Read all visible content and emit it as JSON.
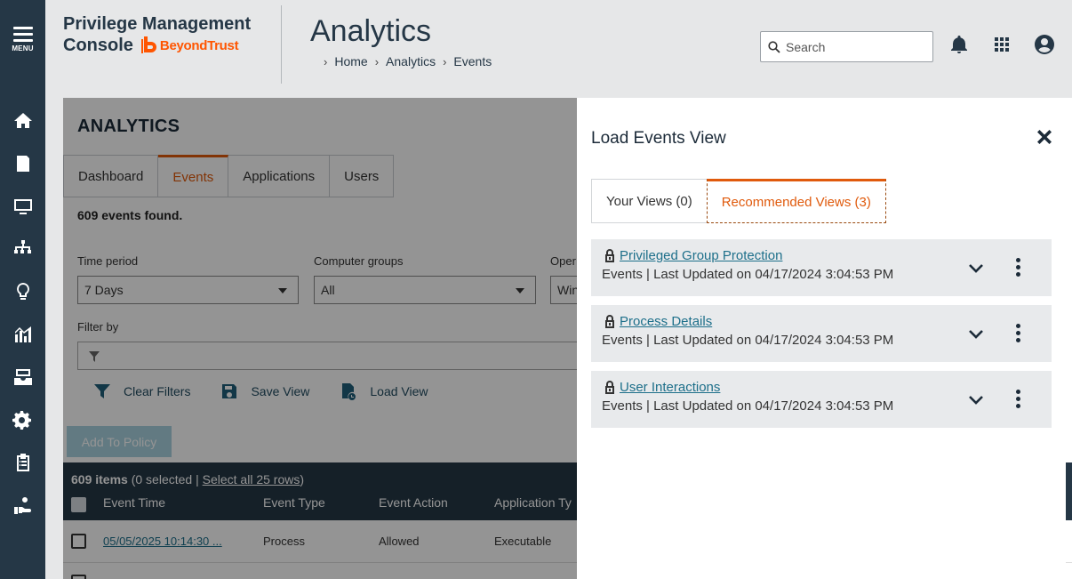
{
  "nav": {
    "menu_label": "MENU",
    "items": [
      "home-icon",
      "policy-icon",
      "computer-icon",
      "org-chart-icon",
      "lightbulb-icon",
      "analytics-icon",
      "inbox-icon",
      "settings-icon",
      "clipboard-icon",
      "hand-icon"
    ]
  },
  "header": {
    "brand_line1": "Privilege Management",
    "brand_line2": "Console",
    "brand_logo": "BeyondTrust",
    "page_title": "Analytics",
    "breadcrumb": [
      "Home",
      "Analytics",
      "Events"
    ],
    "search_placeholder": "Search"
  },
  "main": {
    "section_title": "ANALYTICS",
    "tabs": [
      "Dashboard",
      "Events",
      "Applications",
      "Users"
    ],
    "active_tab": "Events",
    "events_found": "609 events found.",
    "filters": {
      "time_period_label": "Time period",
      "time_period_value": "7 Days",
      "computer_groups_label": "Computer groups",
      "computer_groups_value": "All",
      "os_label_partial": "Oper",
      "os_value_partial": "Win",
      "filter_by_label": "Filter by"
    },
    "actions": {
      "clear_filters": "Clear Filters",
      "save_view": "Save View",
      "load_view": "Load View"
    },
    "add_to_policy": "Add To Policy",
    "grid": {
      "items_count": "609 items",
      "selected": " (0 selected | ",
      "select_all": "Select all 25 rows",
      "select_all_close": ")",
      "columns": [
        "Event Time",
        "Event Type",
        "Event Action",
        "Application Ty"
      ],
      "rows": [
        {
          "event_time": "05/05/2025 10:14:30 ...",
          "event_type": "Process",
          "event_action": "Allowed",
          "application_type": "Executable"
        }
      ]
    }
  },
  "drawer": {
    "title": "Load Events View",
    "tabs": [
      "Your Views (0)",
      "Recommended Views (3)"
    ],
    "active_tab": "Recommended Views (3)",
    "views": [
      {
        "name": "Privileged Group Protection",
        "meta": "Events | Last Updated on 04/17/2024 3:04:53 PM"
      },
      {
        "name": "Process Details",
        "meta": "Events | Last Updated on 04/17/2024 3:04:53 PM"
      },
      {
        "name": "User Interactions",
        "meta": "Events | Last Updated on 04/17/2024 3:04:53 PM"
      }
    ]
  },
  "colors": {
    "rail": "#253746",
    "accent_orange": "#e05a0c",
    "link_teal": "#1d6f8a",
    "grid_header": "#253746"
  }
}
